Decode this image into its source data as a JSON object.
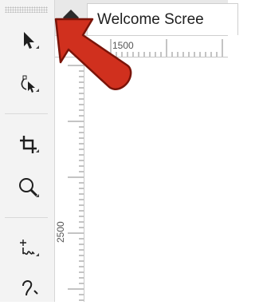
{
  "tab": {
    "title": "Welcome Scree"
  },
  "rulers": {
    "horizontal_label": "1500",
    "vertical_label": "2500"
  },
  "toolbox": {
    "tools": [
      {
        "name": "pick-tool-icon"
      },
      {
        "name": "shape-tool-icon"
      },
      {
        "name": "crop-tool-icon"
      },
      {
        "name": "zoom-tool-icon"
      },
      {
        "name": "freehand-tool-icon"
      },
      {
        "name": "curve-tool-icon"
      }
    ]
  },
  "colors": {
    "annotation_arrow": "#d0301e",
    "annotation_outline": "#7a1409"
  }
}
